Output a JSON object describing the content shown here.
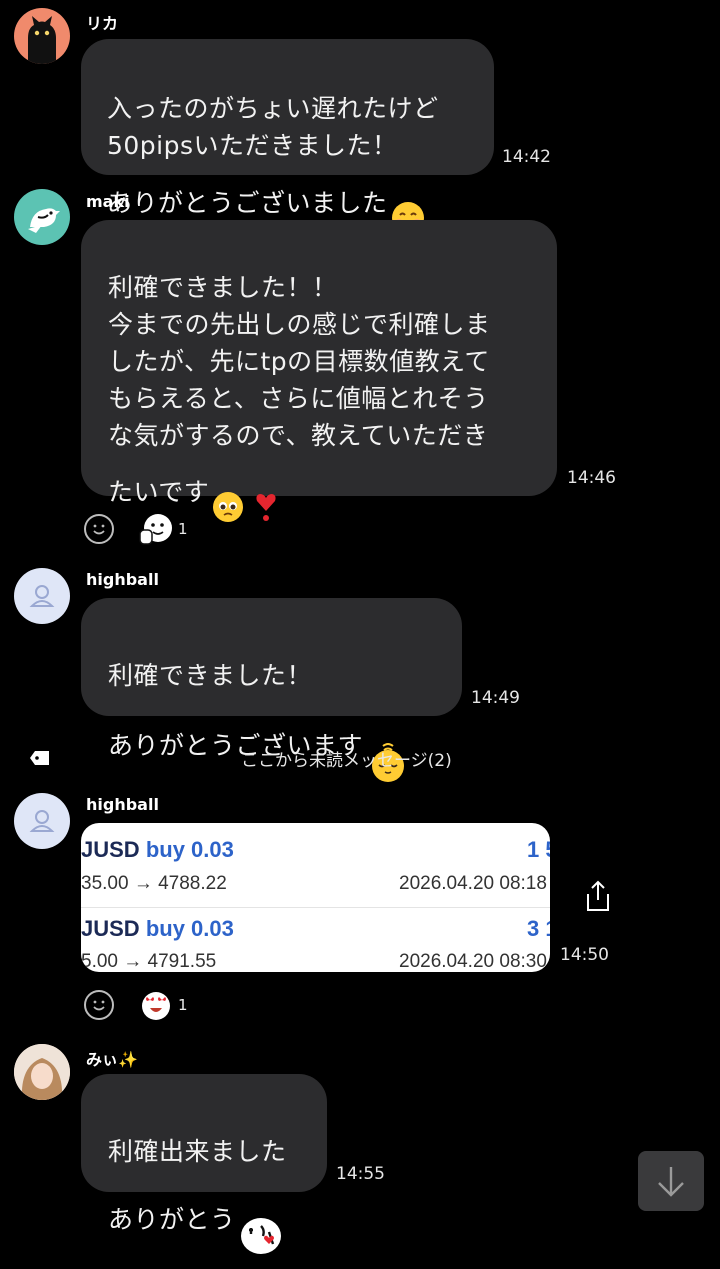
{
  "messages": [
    {
      "sender": "リカ",
      "text": "入ったのがちょい遅れたけど\n50pipsいただきました！\nありがとうございました",
      "time": "14:42"
    },
    {
      "sender": "maki",
      "text": "利確できました！！\n今までの先出しの感じで利確しま\nしたが、先にtpの目標数値教えて\nもらえると、さらに値幅とれそう\nな気がするので、教えていただき\nたいです",
      "time": "14:46",
      "reaction_count": "1"
    },
    {
      "sender": "highball",
      "text": "利確できました！\nありがとうございます",
      "time": "14:49"
    },
    {
      "sender": "highball",
      "time": "14:50",
      "reaction_count": "1",
      "trade_image": {
        "rows": [
          {
            "pair": "JUSD",
            "side": "buy 0.03",
            "profit": "1 5",
            "prices": "35.00 → 4788.22",
            "date": "2026.04.20 08:18"
          },
          {
            "pair": "JUSD",
            "side": "buy 0.03",
            "profit": "3 1",
            "prices": "5.00 → 4791.55",
            "date": "2026.04.20 08:30"
          }
        ]
      }
    },
    {
      "sender": "みぃ✨",
      "text": "利確出来ました\nありがとう",
      "time": "14:55"
    }
  ],
  "unread_divider": "ここから未読メッセージ(2)",
  "icons": {
    "avatar_1": "black-cat-avatar",
    "avatar_2": "bird-avatar",
    "avatar_3": "default-user-avatar",
    "avatar_5": "photo-avatar",
    "reaction_add": "smiley-outline-icon",
    "share": "share-icon",
    "scroll_down": "arrow-down-icon",
    "tag": "tag-icon"
  },
  "colors": {
    "background": "#000000",
    "bubble": "#2c2c2e",
    "profit_blue": "#2d63c9",
    "avatar_1_bg": "#f08a6c",
    "avatar_2_bg": "#5cc3b3",
    "avatar_3_bg": "#dfe6f7"
  }
}
